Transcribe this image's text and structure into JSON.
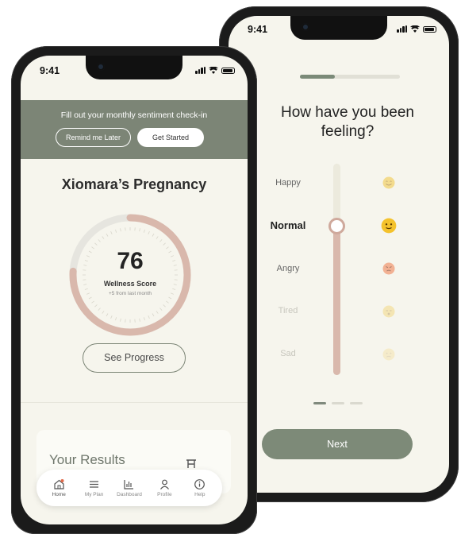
{
  "status_bar": {
    "time_back": "9:41",
    "time_front": "9:41"
  },
  "checkin_screen": {
    "question": "How have you been feeling?",
    "progress": 0.35,
    "moods": [
      {
        "label": "Happy",
        "icon": "happy-face-icon",
        "state": "normal"
      },
      {
        "label": "Normal",
        "icon": "neutral-face-icon",
        "state": "selected"
      },
      {
        "label": "Angry",
        "icon": "angry-face-icon",
        "state": "normal"
      },
      {
        "label": "Tired",
        "icon": "tired-face-icon",
        "state": "faded"
      },
      {
        "label": "Sad",
        "icon": "sad-face-icon",
        "state": "faded"
      }
    ],
    "slider_selected": "Normal",
    "pager": {
      "current": 1,
      "total": 3
    },
    "next_label": "Next"
  },
  "home_screen": {
    "banner": {
      "text": "Fill out your monthly sentiment check-in",
      "later_label": "Remind me Later",
      "start_label": "Get Started"
    },
    "title": "Xiomara’s Pregnancy",
    "wellness": {
      "score": "76",
      "label": "Wellness Score",
      "change": "+5 from last month",
      "fill": 0.76
    },
    "see_progress_label": "See Progress",
    "results": {
      "title": "Your Results",
      "icon": "table-icon"
    },
    "tabs": [
      {
        "label": "Home",
        "icon": "home-icon",
        "active": true
      },
      {
        "label": "My Plan",
        "icon": "menu-icon",
        "active": false
      },
      {
        "label": "Dashboard",
        "icon": "bar-chart-icon",
        "active": false
      },
      {
        "label": "Profile",
        "icon": "profile-icon",
        "active": false
      },
      {
        "label": "Help",
        "icon": "info-icon",
        "active": false
      }
    ]
  },
  "colors": {
    "sage": "#7c8576",
    "blush": "#d9b8ac",
    "background": "#f6f5ed",
    "emoji": "#f2c230"
  }
}
